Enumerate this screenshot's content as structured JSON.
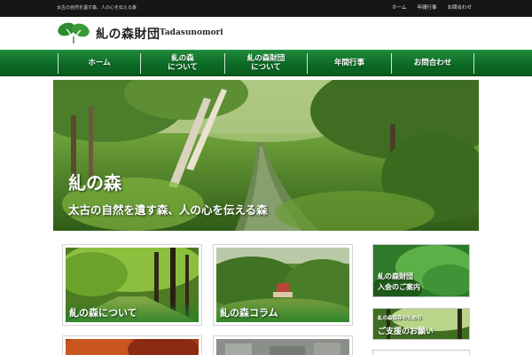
{
  "topbar": {
    "tagline": "太古の自然を遺す森、人の心を伝える森",
    "links": [
      "ホーム",
      "年間行事",
      "お問合わせ"
    ]
  },
  "header": {
    "title": "糺の森財団",
    "romaji": "Tadasunomori"
  },
  "nav": {
    "items": [
      {
        "line1": "ホーム",
        "line2": ""
      },
      {
        "line1": "糺の森",
        "line2": "について"
      },
      {
        "line1": "糺の森財団",
        "line2": "について"
      },
      {
        "line1": "年間行事",
        "line2": ""
      },
      {
        "line1": "お問合わせ",
        "line2": ""
      }
    ]
  },
  "hero": {
    "title": "糺の森",
    "subtitle": "太古の自然を遺す森、人の心を伝える森"
  },
  "cards": [
    {
      "caption": "糺の森について"
    },
    {
      "caption": "糺の森コラム"
    }
  ],
  "side": {
    "banner1_line1": "糺の森財団",
    "banner1_line2": "入会のご案内",
    "banner2_line1": "糺の森保存のための",
    "banner2_line2": "ご支援のお願い"
  },
  "colors": {
    "nav_green": "#0c6a25",
    "topbar": "#161616"
  }
}
